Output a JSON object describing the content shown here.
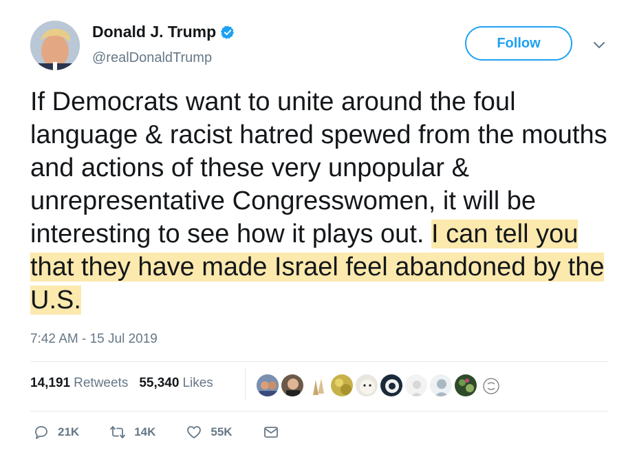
{
  "tweet": {
    "author_name": "Donald J. Trump",
    "handle": "@realDonaldTrump",
    "follow_label": "Follow",
    "text_plain": "If Democrats want to unite around the foul language & racist hatred spewed from the mouths and actions of these very unpopular & unrepresentative Congresswomen, it will be interesting to see how it plays out. ",
    "text_highlighted": "I can tell you that they have made Israel feel abandoned by the U.S.",
    "timestamp": "7:42 AM - 15 Jul 2019",
    "highlight_color": "#fbe9ad"
  },
  "stats": {
    "retweets_count": "14,191",
    "retweets_label": "Retweets",
    "likes_count": "55,340",
    "likes_label": "Likes"
  },
  "actions": {
    "replies": "21K",
    "retweets": "14K",
    "likes": "55K"
  },
  "colors": {
    "accent": "#1da1f2",
    "muted": "#657786",
    "text": "#14171a"
  },
  "icons": [
    "verified-icon",
    "chevron-down-icon",
    "reply-icon",
    "retweet-icon",
    "like-icon",
    "message-icon"
  ]
}
